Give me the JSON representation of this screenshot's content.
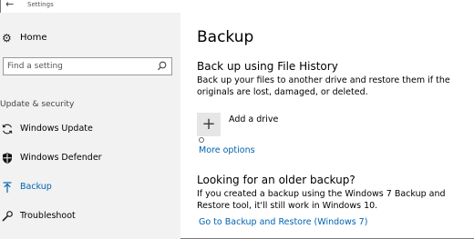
{
  "window": {
    "title": "Settings"
  },
  "sidebar": {
    "home_label": "Home",
    "search_placeholder": "Find a setting",
    "section_label": "Update & security",
    "items": [
      {
        "label": "Windows Update",
        "icon": "sync-icon"
      },
      {
        "label": "Windows Defender",
        "icon": "shield-icon"
      },
      {
        "label": "Backup",
        "icon": "upload-arrow-icon",
        "active": true
      },
      {
        "label": "Troubleshoot",
        "icon": "wrench-icon"
      }
    ]
  },
  "main": {
    "title": "Backup",
    "file_history": {
      "heading": "Back up using File History",
      "description": "Back up your files to another drive and restore them if the originals are lost, damaged, or deleted.",
      "add_drive_label": "Add a drive",
      "more_options_label": "More options"
    },
    "older_backup": {
      "heading": "Looking for an older backup?",
      "description": "If you created a backup using the Windows 7 Backup and Restore tool, it'll still work in Windows 10.",
      "link_label": "Go to Backup and Restore (Windows 7)"
    }
  },
  "colors": {
    "accent": "#0063b1",
    "sidebar_bg": "#f2f2f2"
  }
}
